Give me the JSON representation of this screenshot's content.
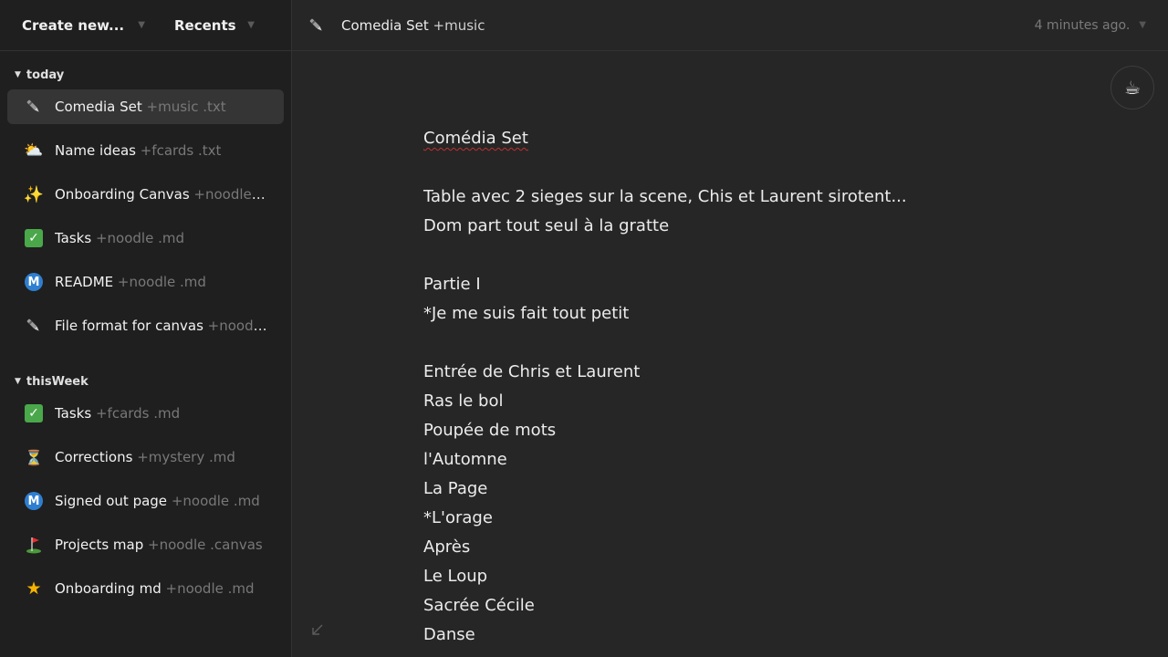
{
  "sidebar": {
    "create_label": "Create new...",
    "recents_label": "Recents",
    "sections": [
      {
        "title": "today",
        "items": [
          {
            "icon": "pen-icon",
            "title": "Comedia Set",
            "meta": " +music .txt",
            "active": true
          },
          {
            "icon": "sun-cloud-icon",
            "title": "Name ideas",
            "meta": " +fcards .txt"
          },
          {
            "icon": "sparkles-icon",
            "title": "Onboarding Canvas",
            "meta": " +noodle .c..."
          },
          {
            "icon": "check-icon",
            "title": "Tasks",
            "meta": " +noodle .md"
          },
          {
            "icon": "m-icon",
            "title": "README",
            "meta": " +noodle .md"
          },
          {
            "icon": "pen-icon",
            "title": "File format for canvas",
            "meta": " +noodle ..."
          }
        ]
      },
      {
        "title": "thisWeek",
        "items": [
          {
            "icon": "check-icon",
            "title": "Tasks",
            "meta": " +fcards .md"
          },
          {
            "icon": "hourglass-icon",
            "title": "Corrections",
            "meta": " +mystery .md"
          },
          {
            "icon": "m-icon",
            "title": "Signed out page",
            "meta": " +noodle .md"
          },
          {
            "icon": "golf-flag-icon",
            "title": "Projects map",
            "meta": " +noodle .canvas"
          },
          {
            "icon": "star-icon",
            "title": "Onboarding md",
            "meta": " +noodle .md"
          }
        ]
      }
    ]
  },
  "header": {
    "doc_title": "Comedia Set",
    "doc_tag": " +music",
    "updated": "4 minutes ago."
  },
  "avatar_icon": "coffee-icon",
  "editor": {
    "lines": [
      "Comédia Set",
      "",
      "Table avec 2 sieges sur la scene, Chis et Laurent sirotent...",
      "Dom part tout seul à la gratte",
      "",
      "Partie I",
      "*Je me suis fait tout petit",
      "",
      "Entrée de Chris et Laurent",
      "Ras le bol",
      "Poupée de mots",
      "l'Automne",
      "La Page",
      "*L'orage",
      "Après",
      "Le Loup",
      "Sacrée Cécile",
      "Danse"
    ]
  },
  "colors": {
    "background": "#262626",
    "sidebar": "#1f1f1f",
    "active_item": "#353535",
    "meta_text": "#787878"
  }
}
